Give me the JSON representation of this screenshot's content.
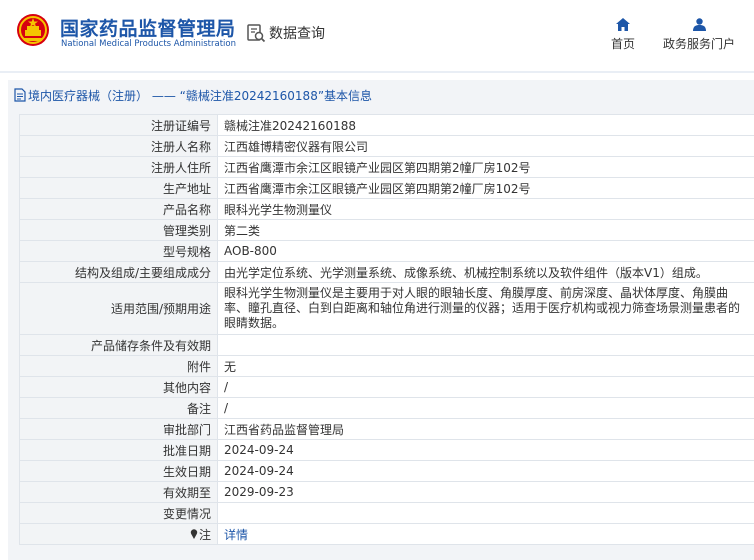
{
  "header": {
    "title_cn": "国家药品监督管理局",
    "title_en": "National Medical Products Administration",
    "query_label": "数据查询",
    "nav_home": "首页",
    "nav_service": "政务服务门户"
  },
  "colors": {
    "brand": "#1d56a8",
    "logo_red": "#d7000f",
    "logo_gold": "#f5c400"
  },
  "breadcrumb": "境内医疗器械（注册） —— “赣械注准20242160188”基本信息",
  "rows": [
    {
      "label": "注册证编号",
      "value": "赣械注准20242160188"
    },
    {
      "label": "注册人名称",
      "value": "江西雄博精密仪器有限公司"
    },
    {
      "label": "注册人住所",
      "value": "江西省鹰潭市余江区眼镜产业园区第四期第2幢厂房102号"
    },
    {
      "label": "生产地址",
      "value": "江西省鹰潭市余江区眼镜产业园区第四期第2幢厂房102号"
    },
    {
      "label": "产品名称",
      "value": "眼科光学生物测量仪"
    },
    {
      "label": "管理类别",
      "value": "第二类"
    },
    {
      "label": "型号规格",
      "value": "AOB-800"
    },
    {
      "label": "结构及组成/主要组成成分",
      "value": "由光学定位系统、光学测量系统、成像系统、机械控制系统以及软件组件（版本V1）组成。"
    },
    {
      "label": "适用范围/预期用途",
      "value": "眼科光学生物测量仪是主要用于对人眼的眼轴长度、角膜厚度、前房深度、晶状体厚度、角膜曲率、瞳孔直径、白到白距离和轴位角进行测量的仪器；适用于医疗机构或视力筛查场景测量患者的眼睛数据。"
    },
    {
      "label": "产品储存条件及有效期",
      "value": ""
    },
    {
      "label": "附件",
      "value": "无"
    },
    {
      "label": "其他内容",
      "value": "/"
    },
    {
      "label": "备注",
      "value": "/"
    },
    {
      "label": "审批部门",
      "value": "江西省药品监督管理局"
    },
    {
      "label": "批准日期",
      "value": "2024-09-24"
    },
    {
      "label": "生效日期",
      "value": "2024-09-24"
    },
    {
      "label": "有效期至",
      "value": "2029-09-23"
    },
    {
      "label": "变更情况",
      "value": ""
    }
  ],
  "note": {
    "label": "注",
    "link": "详情"
  }
}
